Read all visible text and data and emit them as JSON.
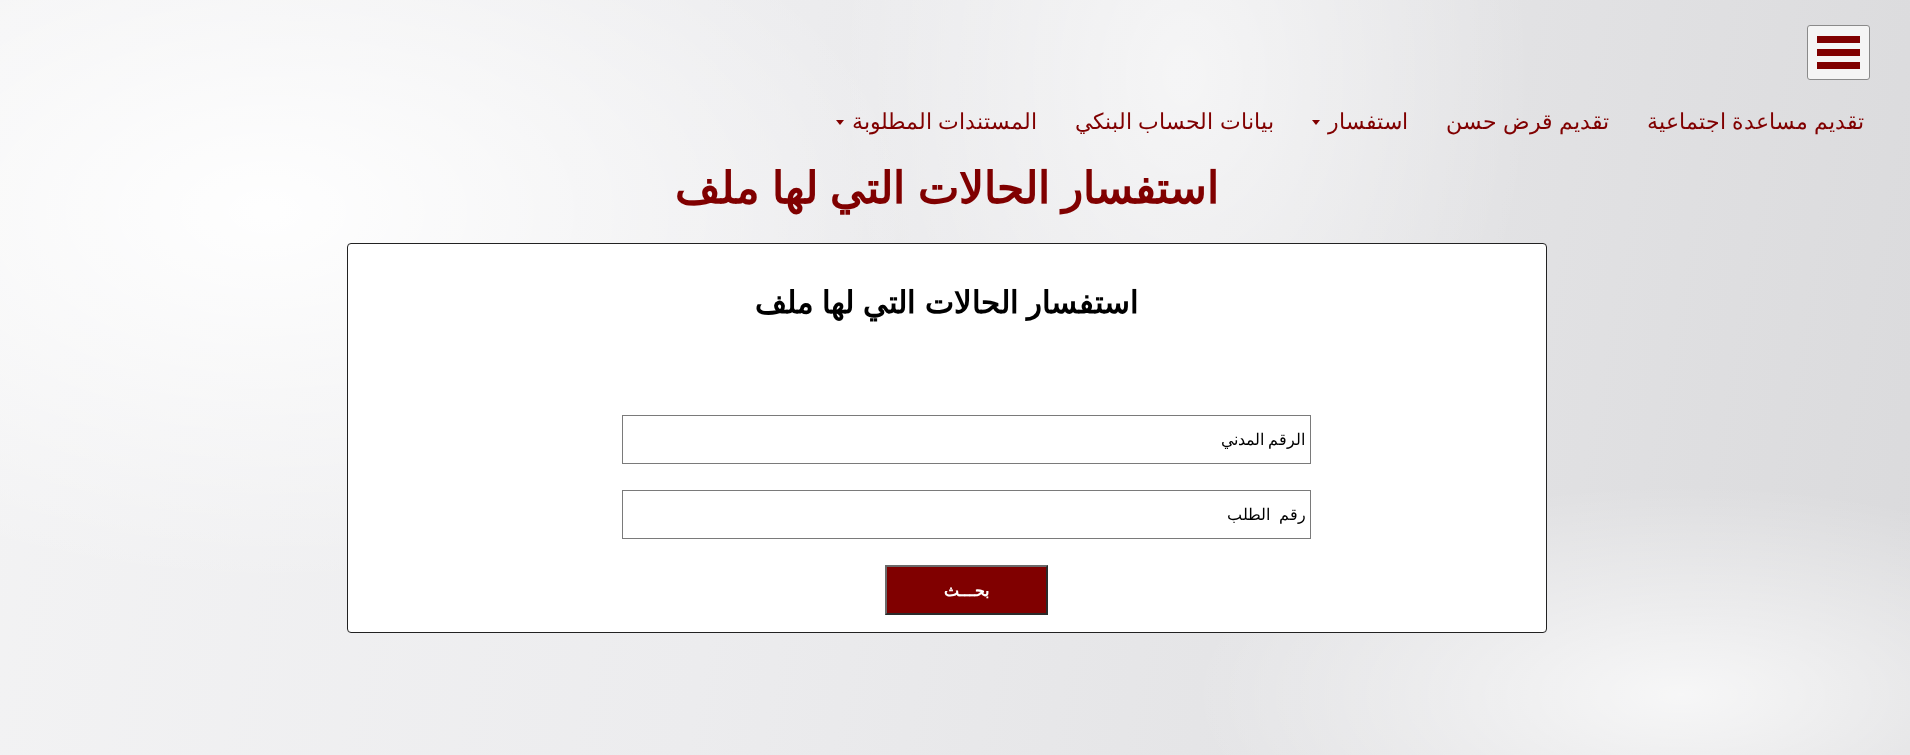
{
  "nav": {
    "items": [
      {
        "label": "تقديم مساعدة اجتماعية",
        "kind": "link"
      },
      {
        "label": "تقديم قرض حسن",
        "kind": "link"
      },
      {
        "label": "استفسار",
        "kind": "dropdown"
      },
      {
        "label": "بيانات الحساب البنكي",
        "kind": "link"
      },
      {
        "label": "المستندات المطلوبة",
        "kind": "dropdown"
      }
    ]
  },
  "page_title": "استفسار الحالات التي لها ملف",
  "form": {
    "heading": "استفسار الحالات التي لها ملف",
    "fields": [
      {
        "placeholder": "الرقم المدني"
      },
      {
        "placeholder": "رقم  الطلب"
      }
    ],
    "submit_button": "بحـــث"
  }
}
